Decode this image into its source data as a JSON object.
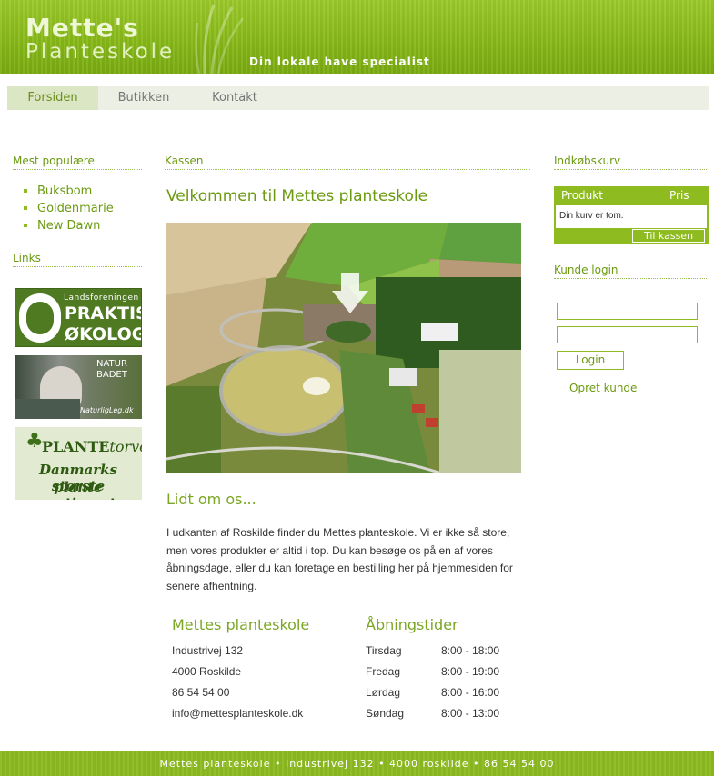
{
  "header": {
    "logo_line1": "Mette's",
    "logo_line2": "Planteskole",
    "tagline": "Din lokale have specialist"
  },
  "nav": {
    "items": [
      {
        "label": "Forsiden",
        "active": true
      },
      {
        "label": "Butikken",
        "active": false
      },
      {
        "label": "Kontakt",
        "active": false
      }
    ]
  },
  "left": {
    "popular_heading": "Mest populære",
    "popular_items": [
      "Buksbom",
      "Goldenmarie",
      "New Dawn"
    ],
    "links_heading": "Links",
    "banners": {
      "b1_small": "Landsforeningen",
      "b1_big1": "PRAKTISK",
      "b1_big2": "ØKOLOGI",
      "b2_line1": "NATUR",
      "b2_line2": "BADET",
      "b2_url": "NaturligLeg.dk",
      "b3_plante": "PLANTE",
      "b3_torvet": "torvet",
      "b3_line1": "Danmarks største",
      "b3_line2": "plante sortiment"
    }
  },
  "main": {
    "section_heading": "Kassen",
    "welcome_title": "Velkommen til Mettes planteskole",
    "about_heading": "Lidt om os...",
    "about_text": "I udkanten af Roskilde finder du Mettes planteskole. Vi er ikke så store, men vores produkter er altid i top. Du kan besøge os på en af vores åbningsdage, eller du kan foretage en bestilling her på hjemmesiden for senere afhentning.",
    "address_heading": "Mettes planteskole",
    "address_lines": [
      "Industrivej 132",
      "4000 Roskilde",
      "86 54 54 00",
      "info@mettesplanteskole.dk"
    ],
    "hours_heading": "Åbningstider",
    "hours": [
      {
        "day": "Tirsdag",
        "time": "8:00 - 18:00"
      },
      {
        "day": "Fredag",
        "time": "8:00 - 19:00"
      },
      {
        "day": "Lørdag",
        "time": "8:00 - 16:00"
      },
      {
        "day": "Søndag",
        "time": "8:00 - 13:00"
      }
    ]
  },
  "right": {
    "cart_heading": "Indkøbskurv",
    "cart_col_product": "Produkt",
    "cart_col_price": "Pris",
    "cart_empty": "Din kurv er tom.",
    "checkout_label": "Til kassen",
    "login_heading": "Kunde login",
    "login_button": "Login",
    "create_customer": "Opret kunde"
  },
  "footer": {
    "text": "Mettes planteskole • Industrivej 132 • 4000 roskilde • 86 54 54 00"
  },
  "colors": {
    "brand_green": "#8dbb20",
    "heading_green": "#6b9a10",
    "nav_bg": "#ecefe3"
  }
}
